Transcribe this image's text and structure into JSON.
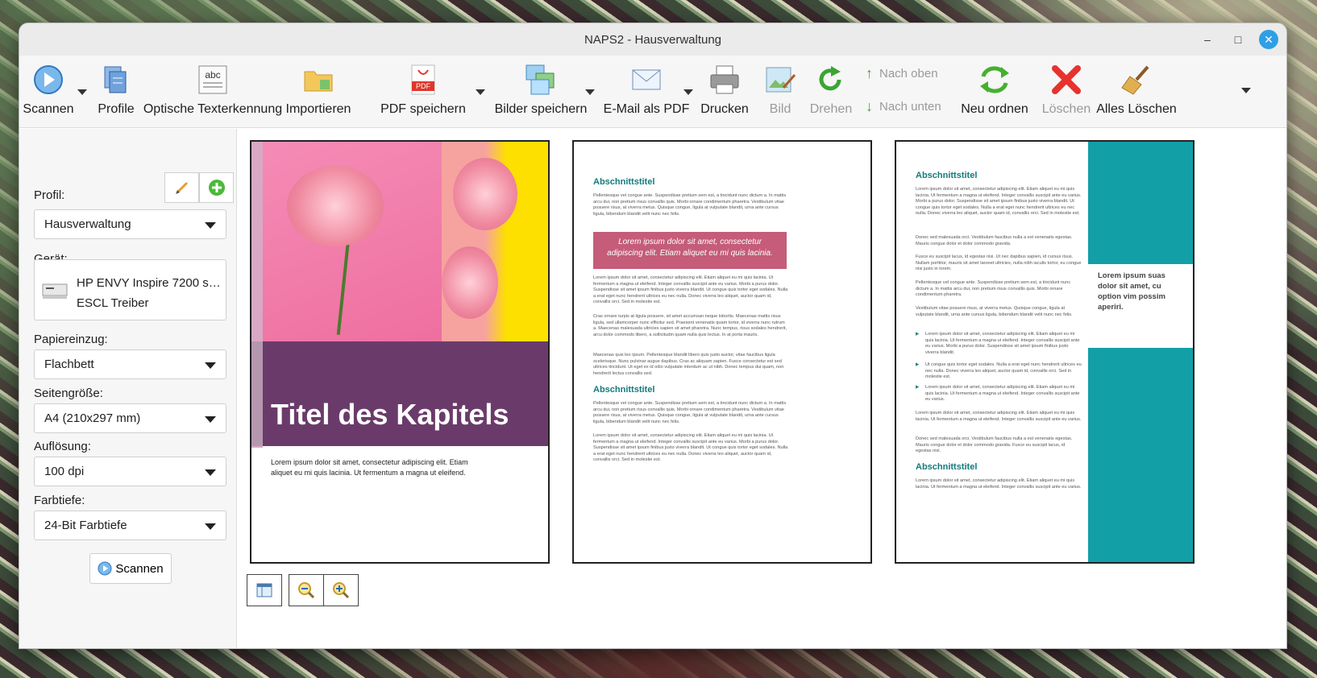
{
  "window": {
    "title": "NAPS2 - Hausverwaltung"
  },
  "toolbar": {
    "scan": "Scannen",
    "profiles": "Profile",
    "ocr": "Optische Texterkennung",
    "import": "Importieren",
    "save_pdf": "PDF speichern",
    "save_images": "Bilder speichern",
    "email_pdf": "E-Mail als PDF",
    "print": "Drucken",
    "image": "Bild",
    "rotate": "Drehen",
    "move_up": "Nach oben",
    "move_down": "Nach unten",
    "reorder": "Neu ordnen",
    "delete": "Löschen",
    "clear_all": "Alles Löschen",
    "ocr_icon_text": "abc",
    "pdf_icon_text": "PDF"
  },
  "sidebar": {
    "profile_label": "Profil:",
    "profile_value": "Hausverwaltung",
    "device_label": "Gerät:",
    "device_name": "HP ENVY Inspire 7200 s…",
    "device_driver": "ESCL Treiber",
    "paper_source_label": "Papiereinzug:",
    "paper_source_value": "Flachbett",
    "page_size_label": "Seitengröße:",
    "page_size_value": "A4 (210x297 mm)",
    "resolution_label": "Auflösung:",
    "resolution_value": "100 dpi",
    "color_depth_label": "Farbtiefe:",
    "color_depth_value": "24-Bit Farbtiefe",
    "scan_button": "Scannen"
  },
  "pages": {
    "p1": {
      "title": "Titel des Kapitels",
      "text": "Lorem ipsum dolor sit amet, consectetur adipiscing elit. Etiam aliquet eu mi quis lacinia. Ut fermentum a magna ut eleifend."
    },
    "p2": {
      "heading1": "Abschnittstitel",
      "para1": "Pellentesque vel congue ante. Suspendisse pretium sem est, a tincidunt nunc dictum a. In mattis arcu dui, non pretium risus convallis quis. Morbi ornare condimentum pharetra. Vestibulum vitae posuere risus, at viverra metus. Quisque congue, ligula at vulputate blandit, urna ante cursus ligula, bibendum blandit velit nunc nec felis.",
      "callout": "Lorem ipsum dolor sit amet, consectetur adipiscing elit. Etiam aliquet eu mi quis lacinia.",
      "para2": "Lorem ipsum dolor sit amet, consectetur adipiscing elit. Etiam aliquet eu mi quis lacinia. Ut fermentum a magna ut eleifend. Integer convallis suscipit ante eu varius. Morbi a purus dolor. Suspendisse sit amet ipsum finibus justo viverra blandit. Ut congue quis tortor eget sodales. Nulla a erat eget nunc hendrerit ultrices eu nec nulla. Donec viverra leo aliquet, auctor quam id, convallis orci. Sed in molestie est.",
      "para3": "Cras ornare turpis at ligula posuere, sit amet accumsan neque lobortis. Maecenas mattis risus ligula, sed ullamcorper nunc efficitur sed. Praesent venenatis quam tortor, id viverra nunc rutrum a. Maecenas malesuada ultricies sapien sit amet pharetra. Nunc tempus, risus sodales hendrerit, arcu dolor commodo libero, a sollicitudin quam nulla quis lectus. In at porta mauris.",
      "para4": "Maecenas quis leo ipsum. Pellentesque blandit libero quis justo auctor, vitae faucibus ligula scelerisque. Nunc pulvinar augue dapibus. Cras ac aliquam sapien. Fusce consectetur est sed ultrices tincidunt. Ut eget ex id odio vulputate interdum ac ut nibh. Donec tempus dui quam, non hendrerit lectus convallis sed.",
      "heading2": "Abschnittstitel",
      "para5": "Pellentesque vel congue ante. Suspendisse pretium sem est, a tincidunt nunc dictum a. In mattis arcu dui, non pretium risus convallis quis. Morbi ornare condimentum pharetra. Vestibulum vitae posuere risus, at viverra metus. Quisque congue, ligula at vulputate blandit, urna ante cursus ligula, bibendum blandit velit nunc nec felis.",
      "para6": "Lorem ipsum dolor sit amet, consectetur adipiscing elit. Etiam aliquet eu mi quis lacinia. Ut fermentum a magna ut eleifend. Integer convallis suscipit ante eu varius. Morbi a purus dolor. Suspendisse sit amet ipsum finibus justo viverra blandit. Ut congue quis tortor eget sodales. Nulla a erat eget nunc hendrerit ultrices eu nec nulla. Donec viverra leo aliquet, auctor quam id, convallis orci. Sed in molestie est."
    },
    "p3": {
      "heading1": "Abschnittstitel",
      "para1": "Lorem ipsum dolor sit amet, consectetur adipiscing elit. Etiam aliquet eu mi quis lacinia. Ut fermentum a magna ut eleifend. Integer convallis suscipit ante eu varius. Morbi a purus dolor. Suspendisse sit amet ipsum finibus justo viverra blandit. Ut congue quis tortor eget sodales. Nulla a erat eget nunc hendrerit ultrices eu nec nulla. Donec viverra leo aliquet, auctor quam id, convallis orci. Sed in molestie est.",
      "para2": "Donec sed malesuada orci. Vestibulum faucibus nulla a est venenatis egestas. Mauris congue dolor et dolor commodo gravida.",
      "para3": "Fusce eu suscipit lacus, id egestas nisi. Ut nec dapibus sapien, id cursus risus. Nullam porttitor, mauris sit amet laoreet ultricies, nulla nibh iaculis tortor, eu congue nisi justo in lorem.",
      "para4": "Pellentesque vel congue ante. Suspendisse pretium sem est, a tincidunt nunc dictum a. In mattis arcu dui, non pretium risus convallis quis. Morbi ornare condimentum pharetra.",
      "para5": "Vestibulum vitae posuere risus, at viverra metus. Quisque congue, ligula at vulputate blandit, urna ante cursus ligula, bibendum blandit velit nunc nec felis.",
      "bullet1": "Lorem ipsum dolor sit amet, consectetur adipiscing elit. Etiam aliquet eu mi quis lacinia. Ut fermentum a magna ut eleifend. Integer convallis suscipit ante eu varius. Morbi a purus dolor. Suspendisse sit amet ipsum finibus justo viverra blandit.",
      "bullet2": "Ut congue quis tortor eget sodales. Nulla a erat eget nunc hendrerit ultrices eu nec nulla. Donec viverra leo aliquet, auctor quam id, convallis orci. Sed in molestie est.",
      "bullet3": "Lorem ipsum dolor sit amet, consectetur adipiscing elit. Etiam aliquet eu mi quis lacinia. Ut fermentum a magna ut eleifend. Integer convallis suscipit ante eu varius.",
      "para6": "Lorem ipsum dolor sit amet, consectetur adipiscing elit. Etiam aliquet eu mi quis lacinia. Ut fermentum a magna ut eleifend. Integer convallis suscipit ante eu varius.",
      "para7": "Donec sed malesuada orci. Vestibulum faucibus nulla a est venenatis egestas. Mauris congue dolor et dolor commodo gravida. Fusce eu suscipit lacus, id egestas nisi.",
      "heading2": "Abschnittstitel",
      "para8": "Lorem ipsum dolor sit amet, consectetur adipiscing elit. Etiam aliquet eu mi quis lacinia. Ut fermentum a magna ut eleifend. Integer convallis suscipit ante eu varius.",
      "quote": "Lorem ipsum suas dolor sit amet, cu option vim possim aperiri."
    }
  },
  "icons": {
    "scan": "scan-icon",
    "profiles": "profiles-icon",
    "ocr": "ocr-icon",
    "import": "import-folder-icon",
    "pdf": "pdf-icon",
    "images": "images-icon",
    "email": "email-icon",
    "print": "printer-icon",
    "image": "image-edit-icon",
    "rotate": "rotate-icon",
    "up": "arrow-up-icon",
    "down": "arrow-down-icon",
    "reorder": "reorder-icon",
    "delete": "delete-icon",
    "clear": "broom-icon",
    "edit": "pencil-icon",
    "add": "plus-icon",
    "thumbnail": "thumbnail-view-icon",
    "zoom_out": "zoom-out-icon",
    "zoom_in": "zoom-in-icon"
  },
  "colors": {
    "accent": "#2f9fe5",
    "teal": "#12a0a6",
    "plum": "#6a3b6a",
    "rose": "#c45c7a",
    "heading_teal": "#137b7b"
  }
}
